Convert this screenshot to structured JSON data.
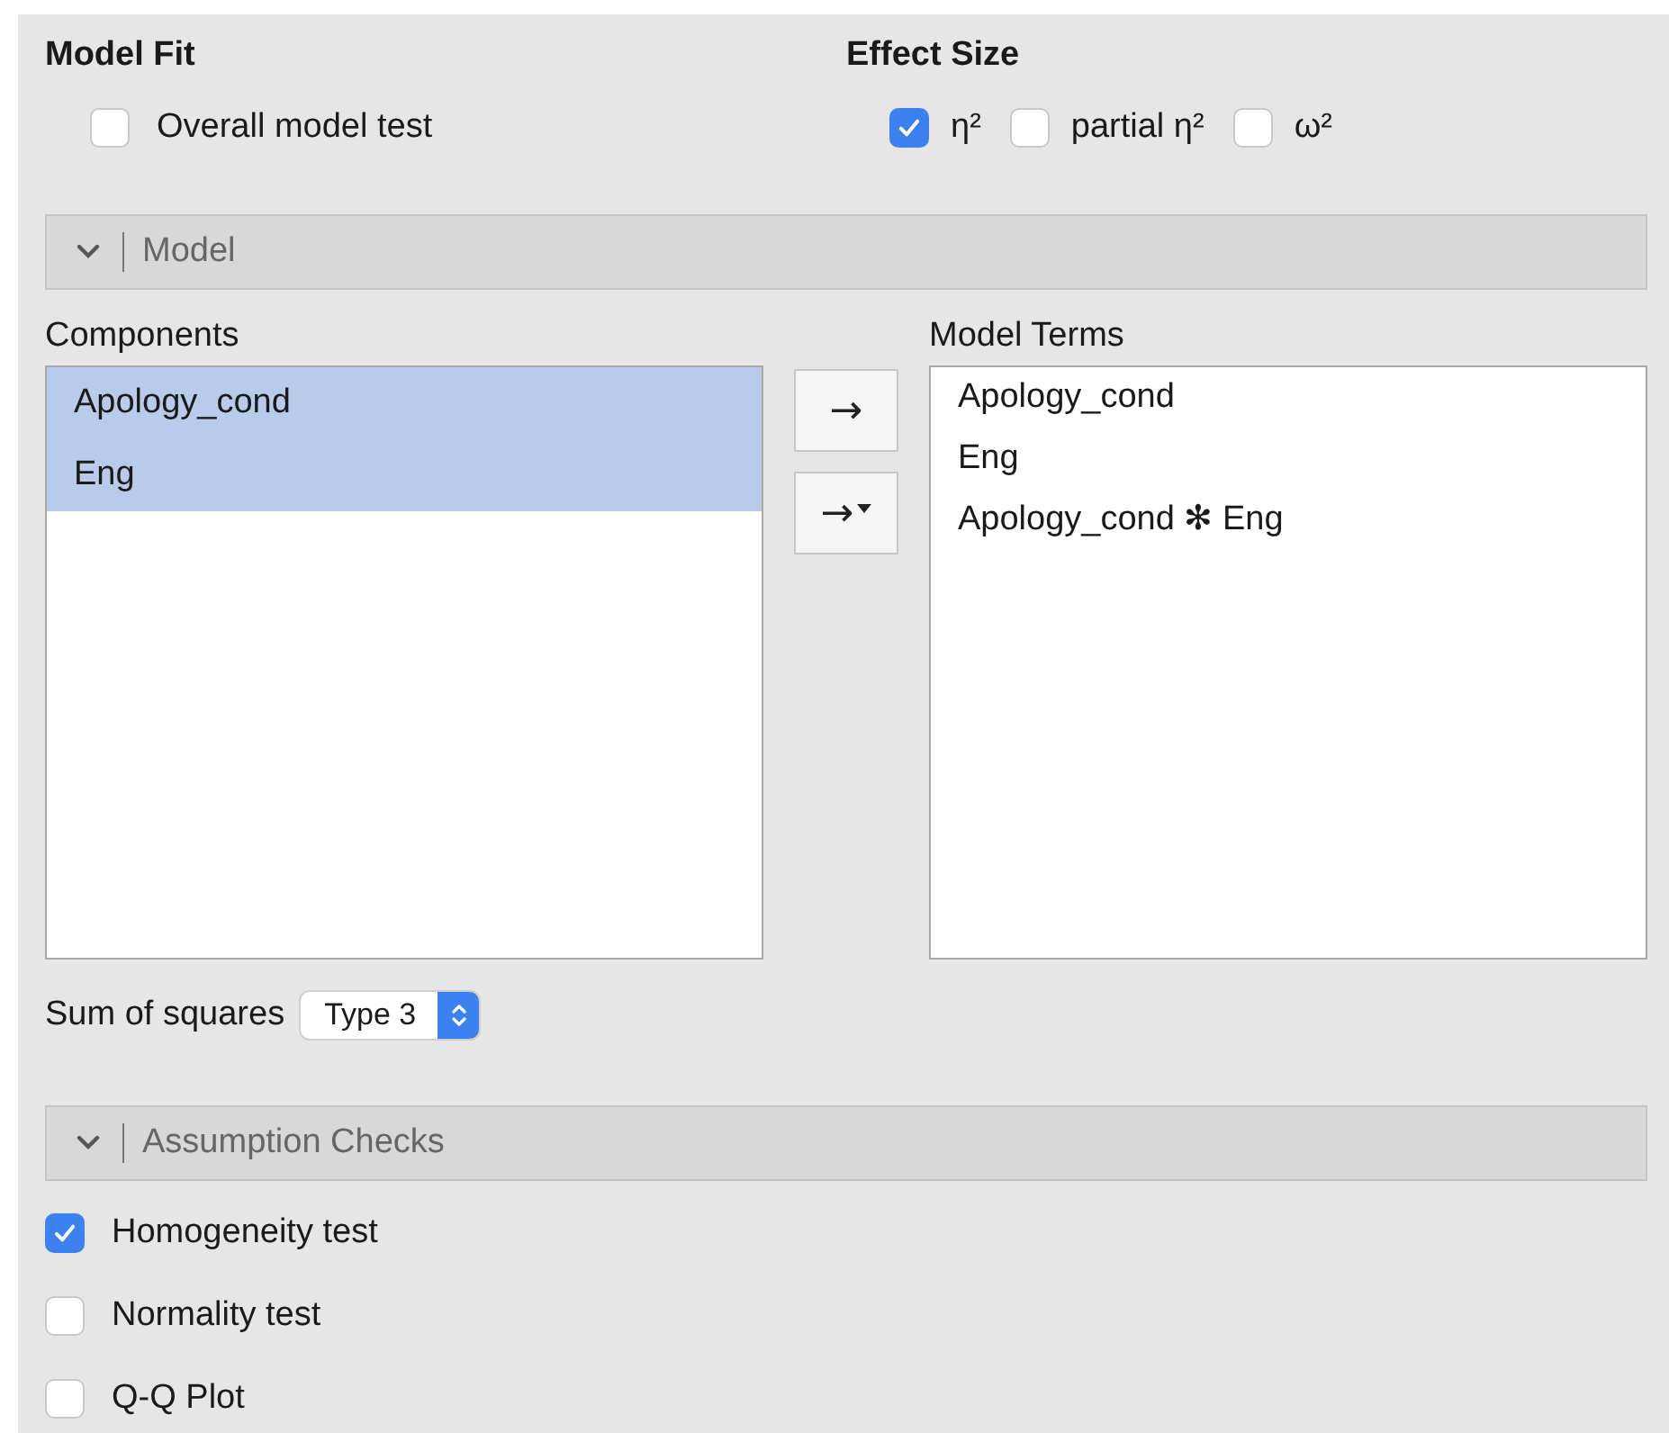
{
  "model_fit": {
    "heading": "Model Fit",
    "options": [
      {
        "label": "Overall model test",
        "checked": false
      }
    ]
  },
  "effect_size": {
    "heading": "Effect Size",
    "options": [
      {
        "label": "η²",
        "checked": true
      },
      {
        "label": "partial η²",
        "checked": false
      },
      {
        "label": "ω²",
        "checked": false
      }
    ]
  },
  "model_section": {
    "title": "Model",
    "expanded": true
  },
  "components": {
    "label": "Components",
    "items": [
      {
        "text": "Apology_cond",
        "selected": true
      },
      {
        "text": "Eng",
        "selected": true
      }
    ]
  },
  "move_buttons": [
    {
      "symbol": "→",
      "kind": "plain"
    },
    {
      "symbol": "→",
      "kind": "menu"
    }
  ],
  "model_terms": {
    "label": "Model Terms",
    "items": [
      {
        "text": "Apology_cond",
        "selected": false
      },
      {
        "text": "Eng",
        "selected": false
      },
      {
        "text": "Apology_cond ✻ Eng",
        "selected": false
      }
    ]
  },
  "sum_of_squares": {
    "label": "Sum of squares",
    "value": "Type 3"
  },
  "assumption_checks": {
    "title": "Assumption Checks",
    "expanded": true,
    "options": [
      {
        "label": "Homogeneity test",
        "checked": true
      },
      {
        "label": "Normality test",
        "checked": false
      },
      {
        "label": "Q-Q Plot",
        "checked": false
      }
    ]
  }
}
